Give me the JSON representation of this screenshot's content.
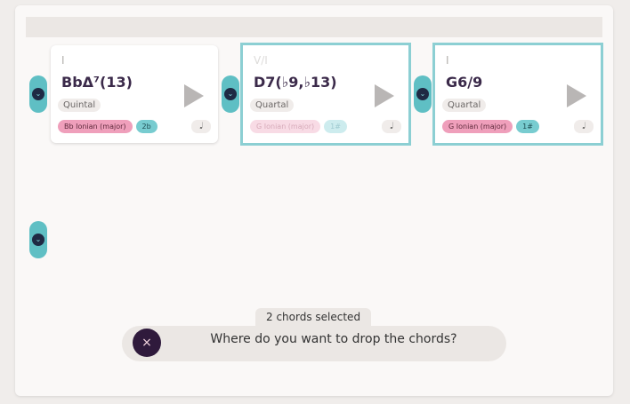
{
  "cards": [
    {
      "roman": "I",
      "chord": "BbΔ⁷(13)",
      "voicing": "Quintal",
      "scale": "Bb Ionian (major)",
      "accidentals": "2b",
      "duration_icon": "half-note-icon",
      "duration_glyph": "𝅗𝅥"
    },
    {
      "roman": "V/I",
      "chord": "D7(♭9,♭13)",
      "voicing": "Quartal",
      "scale": "G Ionian (major)",
      "accidentals": "1#",
      "duration_icon": "half-note-icon",
      "duration_glyph": "𝅗𝅥"
    },
    {
      "roman": "I",
      "chord": "G6/9",
      "voicing": "Quartal",
      "scale": "G Ionian (major)",
      "accidentals": "1#",
      "duration_icon": "half-note-icon",
      "duration_glyph": "𝅗𝅥"
    }
  ],
  "selection": {
    "count_label": "2 chords selected",
    "prompt": "Where do you want to drop the chords?",
    "close_glyph": "×"
  },
  "insert_glyph": "⌄",
  "colors": {
    "accent_teal": "#5fbfc4",
    "selected_border": "#8ccfd3",
    "scale_tag": "#ef9fbb",
    "accidental_tag": "#78ccd0",
    "close_button": "#2f1a3c"
  }
}
